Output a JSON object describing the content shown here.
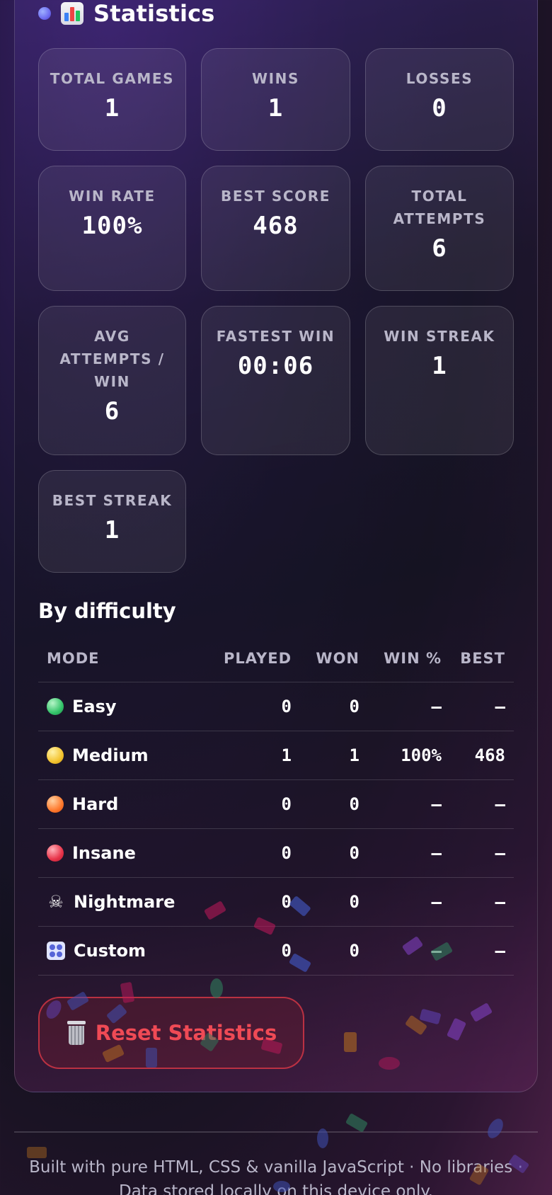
{
  "section": {
    "title": "Statistics",
    "icon": "bar-chart-icon"
  },
  "cards": [
    {
      "label": "TOTAL GAMES",
      "value": "1"
    },
    {
      "label": "WINS",
      "value": "1"
    },
    {
      "label": "LOSSES",
      "value": "0"
    },
    {
      "label": "WIN RATE",
      "value": "100%"
    },
    {
      "label": "BEST SCORE",
      "value": "468"
    },
    {
      "label": "TOTAL ATTEMPTS",
      "value": "6"
    },
    {
      "label": "AVG ATTEMPTS / WIN",
      "value": "6"
    },
    {
      "label": "FASTEST WIN",
      "value": "00:06"
    },
    {
      "label": "WIN STREAK",
      "value": "1"
    },
    {
      "label": "BEST STREAK",
      "value": "1"
    }
  ],
  "difficulty": {
    "heading": "By difficulty",
    "columns": {
      "mode": "MODE",
      "played": "PLAYED",
      "won": "WON",
      "rate": "WIN %",
      "best": "BEST"
    },
    "rows": [
      {
        "mode": "Easy",
        "icon": "green-dot-icon",
        "played": "0",
        "won": "0",
        "rate": "—",
        "best": "—"
      },
      {
        "mode": "Medium",
        "icon": "yellow-dot-icon",
        "played": "1",
        "won": "1",
        "rate": "100%",
        "best": "468"
      },
      {
        "mode": "Hard",
        "icon": "orange-dot-icon",
        "played": "0",
        "won": "0",
        "rate": "—",
        "best": "—"
      },
      {
        "mode": "Insane",
        "icon": "red-dot-icon",
        "played": "0",
        "won": "0",
        "rate": "—",
        "best": "—"
      },
      {
        "mode": "Nightmare",
        "icon": "skull-icon",
        "played": "0",
        "won": "0",
        "rate": "—",
        "best": "—"
      },
      {
        "mode": "Custom",
        "icon": "dice-icon",
        "played": "0",
        "won": "0",
        "rate": "—",
        "best": "—"
      }
    ]
  },
  "reset_button": {
    "label": "Reset Statistics",
    "icon": "trash-icon"
  },
  "footer": {
    "line1": "Built with pure HTML, CSS & vanilla JavaScript · No libraries ·",
    "line2": "Data stored locally on this device only."
  },
  "colors": {
    "accent": "#6e6cf0",
    "danger": "#ef4a55",
    "easy": "#34c46a",
    "medium": "#f4c430",
    "hard": "#ff7a2e",
    "insane": "#e8344a"
  }
}
